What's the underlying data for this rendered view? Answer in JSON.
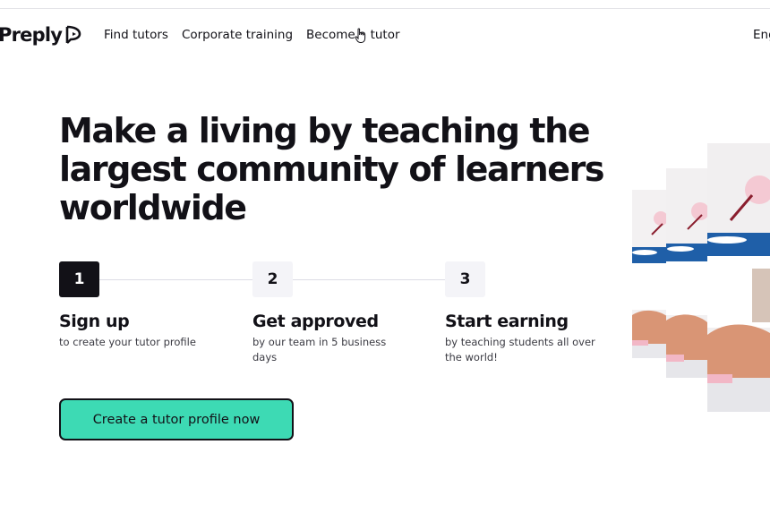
{
  "header": {
    "logo_text": "Preply",
    "nav": [
      "Find tutors",
      "Corporate training",
      "Become a tutor"
    ],
    "language_partial": "Eng"
  },
  "hero": {
    "headline": "Make a living by teaching the largest community of learners worldwide"
  },
  "steps": [
    {
      "number": "1",
      "title": "Sign up",
      "description": "to create your tutor profile",
      "active": true
    },
    {
      "number": "2",
      "title": "Get approved",
      "description": "by our team in 5 business days",
      "active": false
    },
    {
      "number": "3",
      "title": "Start earning",
      "description": "by teaching students all over the world!",
      "active": false
    }
  ],
  "cta": {
    "label": "Create a tutor profile now"
  },
  "colors": {
    "accent": "#3ddab4",
    "text": "#121117",
    "step_inactive": "#f4f4f8",
    "photo_blue": "#1f5fa8"
  },
  "icons": [
    "preply-logo-mark-icon",
    "hand-cursor-icon"
  ]
}
